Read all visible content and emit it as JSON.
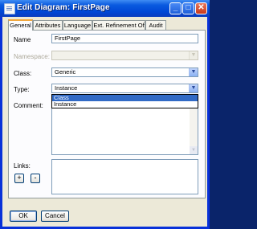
{
  "window": {
    "title": "Edit Diagram: FirstPage",
    "icon": "diagram-icon"
  },
  "title_buttons": {
    "minimize": "_",
    "maximize": "□",
    "close": "✕"
  },
  "tabs": [
    {
      "label": "General"
    },
    {
      "label": "Attributes"
    },
    {
      "label": "Language"
    },
    {
      "label": "Ext. Refinement Of"
    },
    {
      "label": "Audit"
    }
  ],
  "form": {
    "name_label": "Name",
    "name_value": "FirstPage",
    "namespace_label": "Namespace:",
    "namespace_value": "",
    "class_label": "Class:",
    "class_value": "Generic",
    "type_label": "Type:",
    "type_value": "Instance",
    "type_options": [
      "Class",
      "Instance"
    ],
    "comment_label": "Comment:",
    "links_label": "Links:",
    "add_label": "+",
    "remove_label": "-"
  },
  "buttons": {
    "ok": "OK",
    "cancel": "Cancel"
  },
  "colors": {
    "accent": "#316ac5",
    "title_bar": "#0a5adf",
    "tab_highlight": "#f1a63b"
  }
}
